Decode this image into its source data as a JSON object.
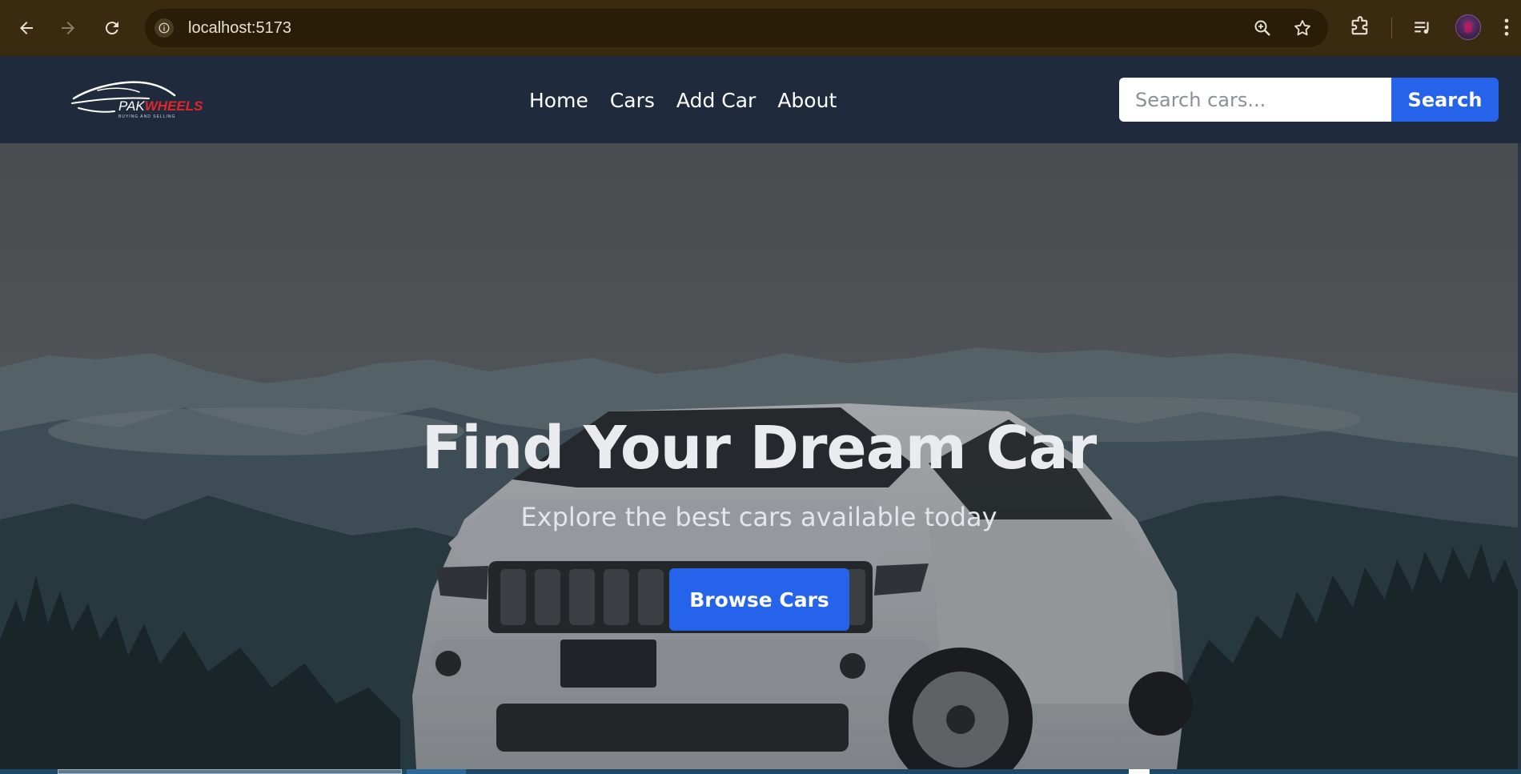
{
  "browser": {
    "url": "localhost:5173",
    "icons": [
      "back-arrow-icon",
      "forward-arrow-icon",
      "reload-icon",
      "site-info-icon",
      "zoom-icon",
      "bookmark-star-icon",
      "extensions-icon",
      "media-control-icon",
      "profile-avatar",
      "more-menu-icon"
    ]
  },
  "site": {
    "logo": {
      "pak": "PAK",
      "wheels": "WHEELS",
      "tagline": "BUYING AND SELLING"
    },
    "nav": [
      {
        "label": "Home"
      },
      {
        "label": "Cars"
      },
      {
        "label": "Add Car"
      },
      {
        "label": "About"
      }
    ],
    "search": {
      "placeholder": "Search cars...",
      "button_label": "Search"
    },
    "colors": {
      "header_bg": "#1f2a3d",
      "accent": "#2563eb",
      "brand_red": "#e0262b"
    }
  },
  "hero": {
    "title": "Find Your Dream Car",
    "subtitle": "Explore the best cars available today",
    "cta_label": "Browse Cars"
  }
}
